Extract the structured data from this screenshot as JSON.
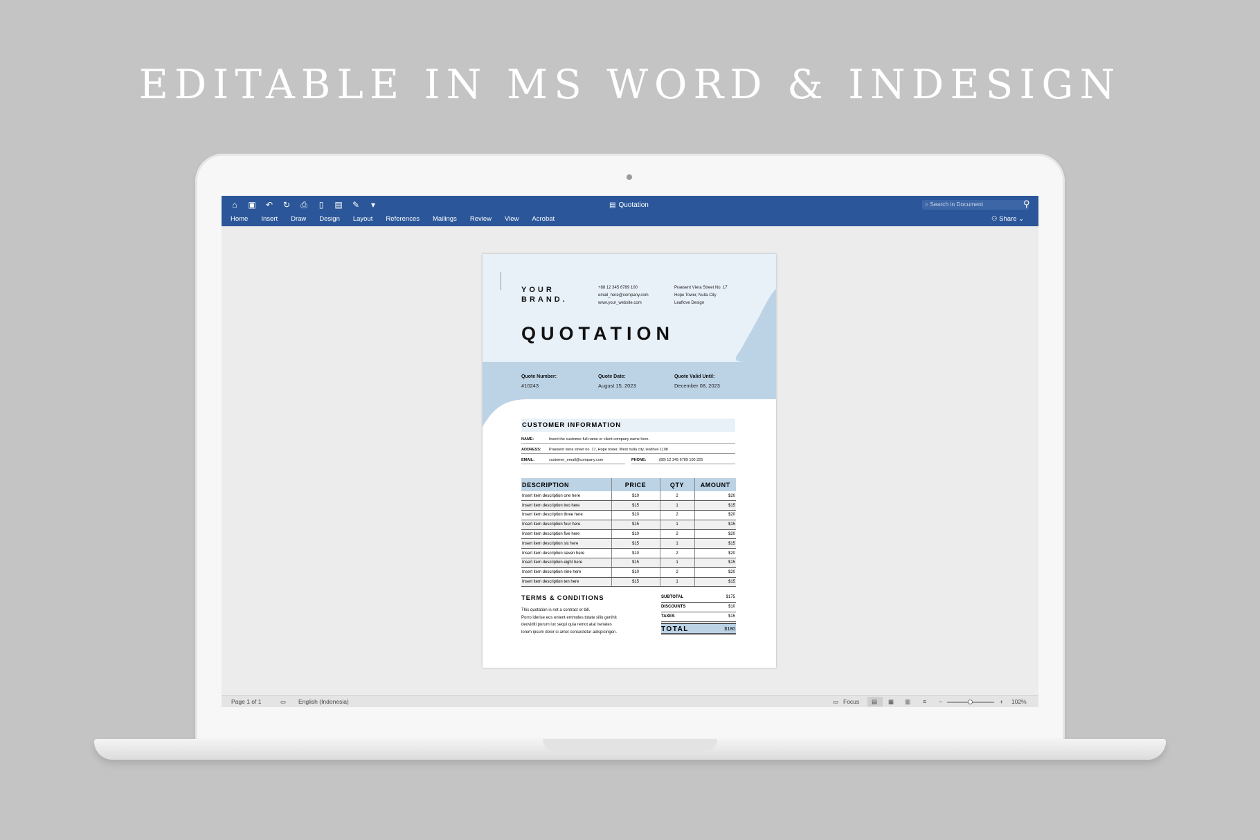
{
  "headline": "EDITABLE IN MS WORD & INDESIGN",
  "word": {
    "doc_title": "Quotation",
    "search_placeholder": "Search in Document",
    "tabs": [
      "Home",
      "Insert",
      "Draw",
      "Design",
      "Layout",
      "References",
      "Mailings",
      "Review",
      "View",
      "Acrobat"
    ],
    "share_label": "Share",
    "status": {
      "page": "Page 1 of 1",
      "language": "English (Indonesia)",
      "focus": "Focus",
      "zoom": "102%",
      "zoom_level": 0.5
    }
  },
  "doc": {
    "brand_line1": "YOUR",
    "brand_line2": "BRAND.",
    "phone": "+88 12 345 6789 100",
    "email": "email_here@company.com",
    "website": "www.your_website.com",
    "addr1": "Praesent Viera Street No. 17",
    "addr2": "Hope Tower, Nulla City",
    "addr3": "Leaflove Design",
    "title": "QUOTATION",
    "quote_number_label": "Quote Number:",
    "quote_number": "#10243",
    "quote_date_label": "Quote Date:",
    "quote_date": "August 15, 2023",
    "valid_label": "Quote Valid Until:",
    "valid_date": "December 08, 2023",
    "customer_head": "CUSTOMER INFORMATION",
    "name_label": "NAME:",
    "name_value": "Insert the customer full name or client company name here.",
    "address_label": "ADDRESS:",
    "address_value": "Praesent viera street no. 17, Hope tower, West nulla city, leaflove 1108",
    "email_label": "EMAIL:",
    "email_value": "customer_email@company.com",
    "phone_label": "PHONE:",
    "phone_value": "(88) 12 345 6789 100 225",
    "col_description": "DESCRIPTION",
    "col_price": "PRICE",
    "col_qty": "QTY",
    "col_amount": "AMOUNT",
    "items": [
      {
        "desc": "Insert item description one here",
        "price": "$10",
        "qty": "2",
        "amount": "$20"
      },
      {
        "desc": "Insert item description two here",
        "price": "$15",
        "qty": "1",
        "amount": "$15"
      },
      {
        "desc": "Insert item description three here",
        "price": "$10",
        "qty": "2",
        "amount": "$20"
      },
      {
        "desc": "Insert item description four here",
        "price": "$15",
        "qty": "1",
        "amount": "$15"
      },
      {
        "desc": "Insert item description five here",
        "price": "$10",
        "qty": "2",
        "amount": "$20"
      },
      {
        "desc": "Insert item description six here",
        "price": "$15",
        "qty": "1",
        "amount": "$15"
      },
      {
        "desc": "Insert item description seven here",
        "price": "$10",
        "qty": "2",
        "amount": "$20"
      },
      {
        "desc": "Insert item description eight here",
        "price": "$15",
        "qty": "1",
        "amount": "$15"
      },
      {
        "desc": "Insert item description nine here",
        "price": "$10",
        "qty": "2",
        "amount": "$20"
      },
      {
        "desc": "Insert item description ten here",
        "price": "$15",
        "qty": "1",
        "amount": "$15"
      }
    ],
    "terms_head": "TERMS & CONDITIONS",
    "terms_line1": "This quotation is not a contract or bill.",
    "terms_line2": "Porro iderise eos entent emmoles totate silio genihit",
    "terms_line3": "deoviditi purum lux sequi quia remot atat nenates",
    "terms_line4": "lorem ipsum dolor si amet consectetur adispicingen.",
    "subtotal_label": "SUBTOTAL",
    "subtotal": "$175",
    "discounts_label": "DISCOUNTS",
    "discounts": "$10",
    "taxes_label": "TAXES",
    "taxes": "$15",
    "total_label": "TOTAL",
    "total": "$180"
  },
  "colors": {
    "word_blue": "#2b579a",
    "page_header_light": "#e8f0f8",
    "page_header_band": "#bcd3e6",
    "background": "#c4c4c4"
  },
  "icons": [
    "home-icon",
    "save-icon",
    "undo-icon",
    "redo-icon",
    "print-icon",
    "new-doc-icon",
    "format-icon",
    "edit-icon",
    "customize-icon",
    "search-icon",
    "profile-icon",
    "add-person-icon",
    "chevron-down-icon",
    "document-icon"
  ]
}
